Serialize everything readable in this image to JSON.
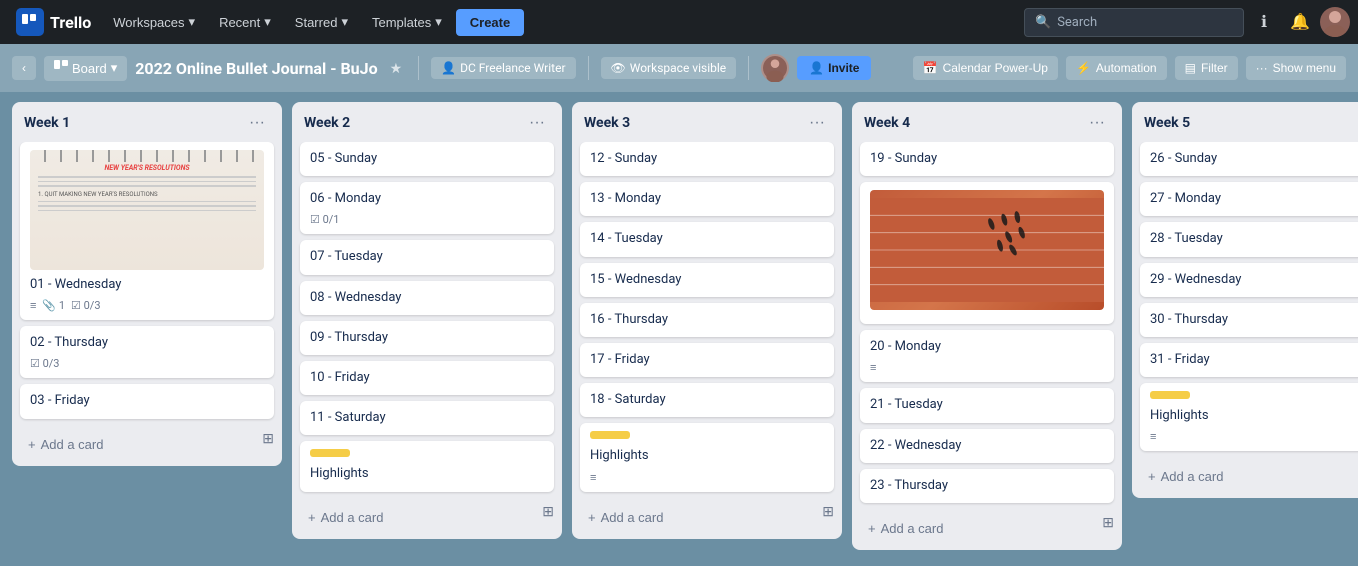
{
  "nav": {
    "logo": "Trello",
    "workspaces": "Workspaces",
    "recent": "Recent",
    "starred": "Starred",
    "templates": "Templates",
    "create": "Create",
    "search_placeholder": "Search",
    "chevron": "▾"
  },
  "board_header": {
    "view": "Board",
    "title": "2022 Online Bullet Journal - BuJo",
    "workspace_tag": "DC Freelance Writer",
    "visibility": "Workspace visible",
    "invite": "Invite",
    "calendar": "Calendar Power-Up",
    "automation": "Automation",
    "filter": "Filter",
    "show_menu": "Show menu"
  },
  "lists": [
    {
      "title": "Week 1",
      "cards": [
        {
          "title": "01 - Wednesday",
          "has_image": true,
          "image_type": "notebook",
          "meta": [
            {
              "type": "lines"
            },
            {
              "type": "attach",
              "val": "1"
            },
            {
              "type": "checklist",
              "val": "0/3"
            }
          ]
        },
        {
          "title": "02 - Thursday",
          "meta": [
            {
              "type": "checklist",
              "val": "0/3"
            }
          ]
        },
        {
          "title": "03 - Friday",
          "meta": []
        }
      ],
      "add": "Add a card"
    },
    {
      "title": "Week 2",
      "cards": [
        {
          "title": "05 - Sunday",
          "meta": []
        },
        {
          "title": "06 - Monday",
          "meta": [
            {
              "type": "checklist",
              "val": "0/1"
            }
          ]
        },
        {
          "title": "07 - Tuesday",
          "meta": []
        },
        {
          "title": "08 - Wednesday",
          "meta": []
        },
        {
          "title": "09 - Thursday",
          "meta": []
        },
        {
          "title": "10 - Friday",
          "meta": []
        },
        {
          "title": "11 - Saturday",
          "meta": []
        },
        {
          "title": "Highlights",
          "label": true,
          "meta": [],
          "partial": true
        }
      ],
      "add": "Add a card"
    },
    {
      "title": "Week 3",
      "cards": [
        {
          "title": "12 - Sunday",
          "meta": []
        },
        {
          "title": "13 - Monday",
          "meta": []
        },
        {
          "title": "14 - Tuesday",
          "meta": []
        },
        {
          "title": "15 - Wednesday",
          "meta": []
        },
        {
          "title": "16 - Thursday",
          "meta": []
        },
        {
          "title": "17 - Friday",
          "meta": []
        },
        {
          "title": "18 - Saturday",
          "meta": []
        },
        {
          "title": "Highlights",
          "label": true,
          "meta": [
            {
              "type": "lines"
            }
          ]
        }
      ],
      "add": "Add a card"
    },
    {
      "title": "Week 4",
      "cards": [
        {
          "title": "19 - Sunday",
          "meta": []
        },
        {
          "title": "",
          "has_image": true,
          "image_type": "track",
          "meta": []
        },
        {
          "title": "20 - Monday",
          "meta": [
            {
              "type": "lines"
            }
          ]
        },
        {
          "title": "21 - Tuesday",
          "meta": []
        },
        {
          "title": "22 - Wednesday",
          "meta": []
        },
        {
          "title": "23 - Thursday",
          "meta": [],
          "partial": true
        }
      ],
      "add": "Add a card"
    },
    {
      "title": "Week 5",
      "cards": [
        {
          "title": "26 - Sunday",
          "meta": []
        },
        {
          "title": "27 - Monday",
          "meta": []
        },
        {
          "title": "28 - Tuesday",
          "meta": []
        },
        {
          "title": "29 - Wednesday",
          "meta": []
        },
        {
          "title": "30 - Thursday",
          "meta": []
        },
        {
          "title": "31 - Friday",
          "meta": []
        },
        {
          "title": "Highlights",
          "label": true,
          "meta": [
            {
              "type": "lines"
            }
          ]
        }
      ],
      "add": "Add a card"
    }
  ],
  "icons": {
    "grid": "⊞",
    "chevron_down": "▾",
    "chevron_left": "‹",
    "star": "★",
    "lock": "🔒",
    "eye": "👁",
    "person_plus": "👤",
    "lightning": "⚡",
    "calendar": "📅",
    "filter": "▤",
    "dots": "···",
    "plus": "+",
    "pencil": "✏",
    "lines": "≡",
    "attach": "📎",
    "check": "☑",
    "search": "🔍",
    "info": "ℹ",
    "bell": "🔔",
    "menu": "⋯"
  }
}
